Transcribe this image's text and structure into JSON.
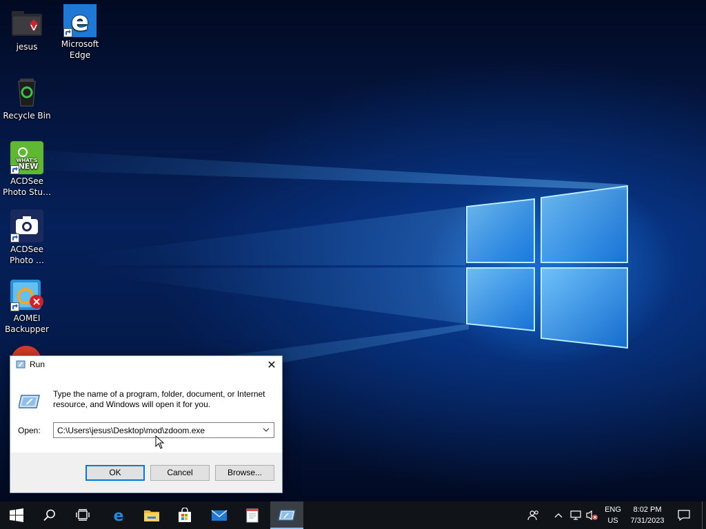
{
  "desktop": {
    "icons": [
      {
        "label": "jesus",
        "icon": "user-folder-icon",
        "shortcut": false
      },
      {
        "label": "Microsoft Edge",
        "icon": "edge-icon",
        "shortcut": true
      },
      {
        "label": "Recycle Bin",
        "icon": "recycle-bin-icon",
        "shortcut": false
      },
      {
        "label": "ACDSee Photo Stu…",
        "icon": "acdsee-whats-new-icon",
        "shortcut": true,
        "badge": "WHAT'S NEW"
      },
      {
        "label": "ACDSee Photo …",
        "icon": "acdsee-camera-icon",
        "shortcut": true
      },
      {
        "label": "AOMEI Backupper",
        "icon": "aomei-backupper-icon",
        "shortcut": true
      }
    ]
  },
  "run_dialog": {
    "title": "Run",
    "close_glyph": "✕",
    "description": "Type the name of a program, folder, document, or Internet resource, and Windows will open it for you.",
    "open_label": "Open:",
    "open_value": "C:\\Users\\jesus\\Desktop\\mod\\zdoom.exe",
    "buttons": {
      "ok": "OK",
      "cancel": "Cancel",
      "browse": "Browse..."
    }
  },
  "taskbar": {
    "pinned": [
      {
        "name": "start",
        "icon": "windows-logo-icon"
      },
      {
        "name": "search",
        "icon": "search-icon"
      },
      {
        "name": "task-view",
        "icon": "task-view-icon"
      },
      {
        "name": "edge",
        "icon": "edge-icon"
      },
      {
        "name": "file-explorer",
        "icon": "folder-icon"
      },
      {
        "name": "store",
        "icon": "store-icon"
      },
      {
        "name": "mail",
        "icon": "mail-icon"
      },
      {
        "name": "notepad",
        "icon": "notepad-icon"
      },
      {
        "name": "run",
        "icon": "run-icon",
        "active": true
      }
    ],
    "tray": {
      "language_line1": "ENG",
      "language_line2": "US",
      "time": "8:02 PM",
      "date": "7/31/2023"
    }
  },
  "colors": {
    "taskbar_bg": "#101418",
    "accent": "#0078d7",
    "edge_blue": "#1e78d4",
    "acdsee_green": "#5fb832",
    "acdsee_navy": "#1b2a5c"
  }
}
